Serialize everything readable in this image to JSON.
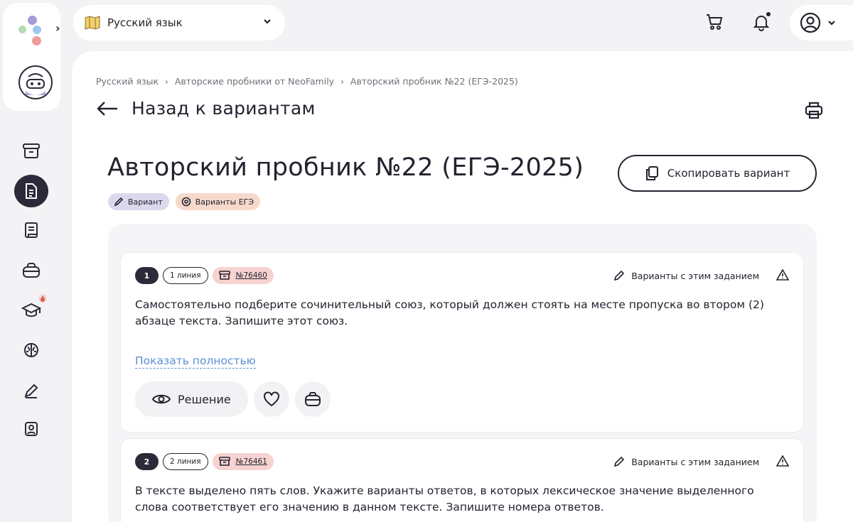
{
  "header": {
    "subject_label": "Русский язык"
  },
  "breadcrumb": {
    "items": [
      "Русский язык",
      "Авторские пробники от NeoFamily",
      "Авторский пробник №22 (ЕГЭ-2025)"
    ]
  },
  "back": {
    "label": "Назад к вариантам"
  },
  "page": {
    "title": "Авторский пробник №22 (ЕГЭ-2025)",
    "copy_button": "Скопировать вариант",
    "tags": [
      "Вариант",
      "Варианты ЕГЭ"
    ]
  },
  "tasks": [
    {
      "number": "1",
      "line": "1 линия",
      "id": "№76460",
      "variants_link": "Варианты с этим заданием",
      "text": "Самостоятельно подберите сочинительный союз, который должен стоять на месте пропуска во втором (2) абзаце текста. Запишите этот союз.",
      "show_more": "Показать полностью",
      "solution": "Решение"
    },
    {
      "number": "2",
      "line": "2 линия",
      "id": "№76461",
      "variants_link": "Варианты с этим заданием",
      "text": "В тексте выделено пять слов. Укажите варианты ответов, в которых лексическое значение выделенного слова соответствует его значению в данном тексте. Запишите номера ответов."
    }
  ],
  "colors": {
    "dark": "#2b2a38",
    "tag_purple": "#dcd7ec",
    "tag_orange": "#f7d9cc",
    "id_badge": "#f6d3d0",
    "link_blue": "#5b8fd6"
  }
}
